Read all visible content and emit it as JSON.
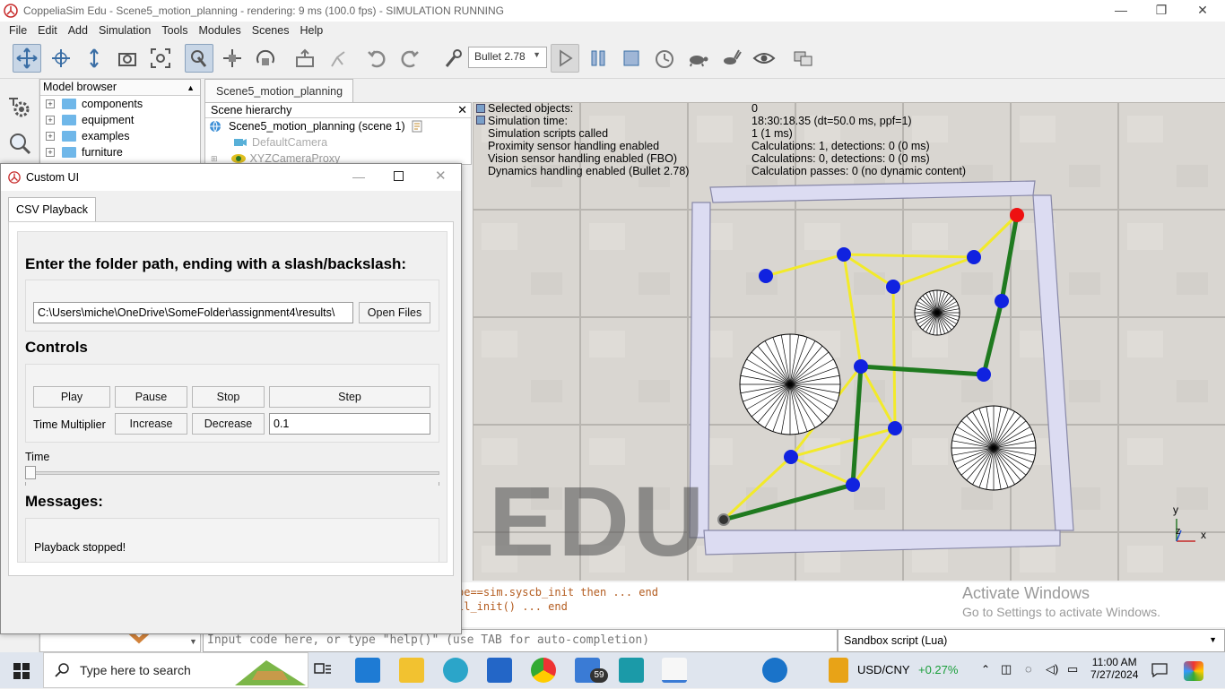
{
  "window": {
    "title": "CoppeliaSim Edu - Scene5_motion_planning - rendering: 9 ms (100.0 fps) - SIMULATION RUNNING"
  },
  "menu": [
    "File",
    "Edit",
    "Add",
    "Simulation",
    "Tools",
    "Modules",
    "Scenes",
    "Help"
  ],
  "toolbar": {
    "physics_engine": "Bullet 2.78"
  },
  "model_browser": {
    "title": "Model browser",
    "items": [
      "components",
      "equipment",
      "examples",
      "furniture"
    ]
  },
  "scene": {
    "tab": "Scene5_motion_planning",
    "hierarchy_title": "Scene hierarchy",
    "rows": [
      "Scene5_motion_planning (scene 1)",
      "DefaultCamera",
      "XYZCameraProxy"
    ]
  },
  "info_overlay": {
    "labels": [
      "Selected objects:",
      "Simulation time:",
      "Simulation scripts called",
      "Proximity sensor handling enabled",
      "Vision sensor handling enabled (FBO)",
      "Dynamics handling enabled (Bullet 2.78)"
    ],
    "values": [
      "0",
      "18:30:18.35 (dt=50.0 ms, ppf=1)",
      "1 (1 ms)",
      "Calculations: 1, detections: 0 (0 ms)",
      "Calculations: 0, detections: 0 (0 ms)",
      "Calculation passes: 0 (no dynamic content)"
    ]
  },
  "viewport": {
    "watermark": "EDU",
    "axes": {
      "y": "y",
      "z": "z",
      "x": "x"
    }
  },
  "console": {
    "lines": [
      "pe==sim.syscb_init then ... end",
      "ll_init() ... end"
    ],
    "input_placeholder": "Input code here, or type \"help()\" (use TAB for auto-completion)",
    "script_type": "Sandbox script (Lua)"
  },
  "activation": {
    "line1": "Activate Windows",
    "line2": "Go to Settings to activate Windows."
  },
  "dialog": {
    "title": "Custom UI",
    "tab": "CSV Playback",
    "folder_prompt": "Enter the folder path, ending with a slash/backslash:",
    "folder_path": "C:\\Users\\miche\\OneDrive\\SomeFolder\\assignment4\\results\\",
    "open_files": "Open Files",
    "controls_header": "Controls",
    "play": "Play",
    "pause": "Pause",
    "stop": "Stop",
    "step": "Step",
    "time_multiplier_label": "Time Multiplier",
    "increase": "Increase",
    "decrease": "Decrease",
    "time_multiplier_value": "0.1",
    "time_label": "Time",
    "time_slider": 0,
    "messages_header": "Messages:",
    "message": "Playback stopped!"
  },
  "taskbar": {
    "search_placeholder": "Type here to search",
    "mail_badge": "59",
    "stock_name": "USD/CNY",
    "stock_change": "+0.27%",
    "stock_color": "#1a9e3a",
    "time": "11:00 AM",
    "date": "7/27/2024"
  },
  "colors": {
    "path_green": "#1f7a1f",
    "roadmap_yellow": "#f2ea2a",
    "node_blue": "#1022e0",
    "goal_red": "#ee1111",
    "wall": "#d8d8f0"
  }
}
